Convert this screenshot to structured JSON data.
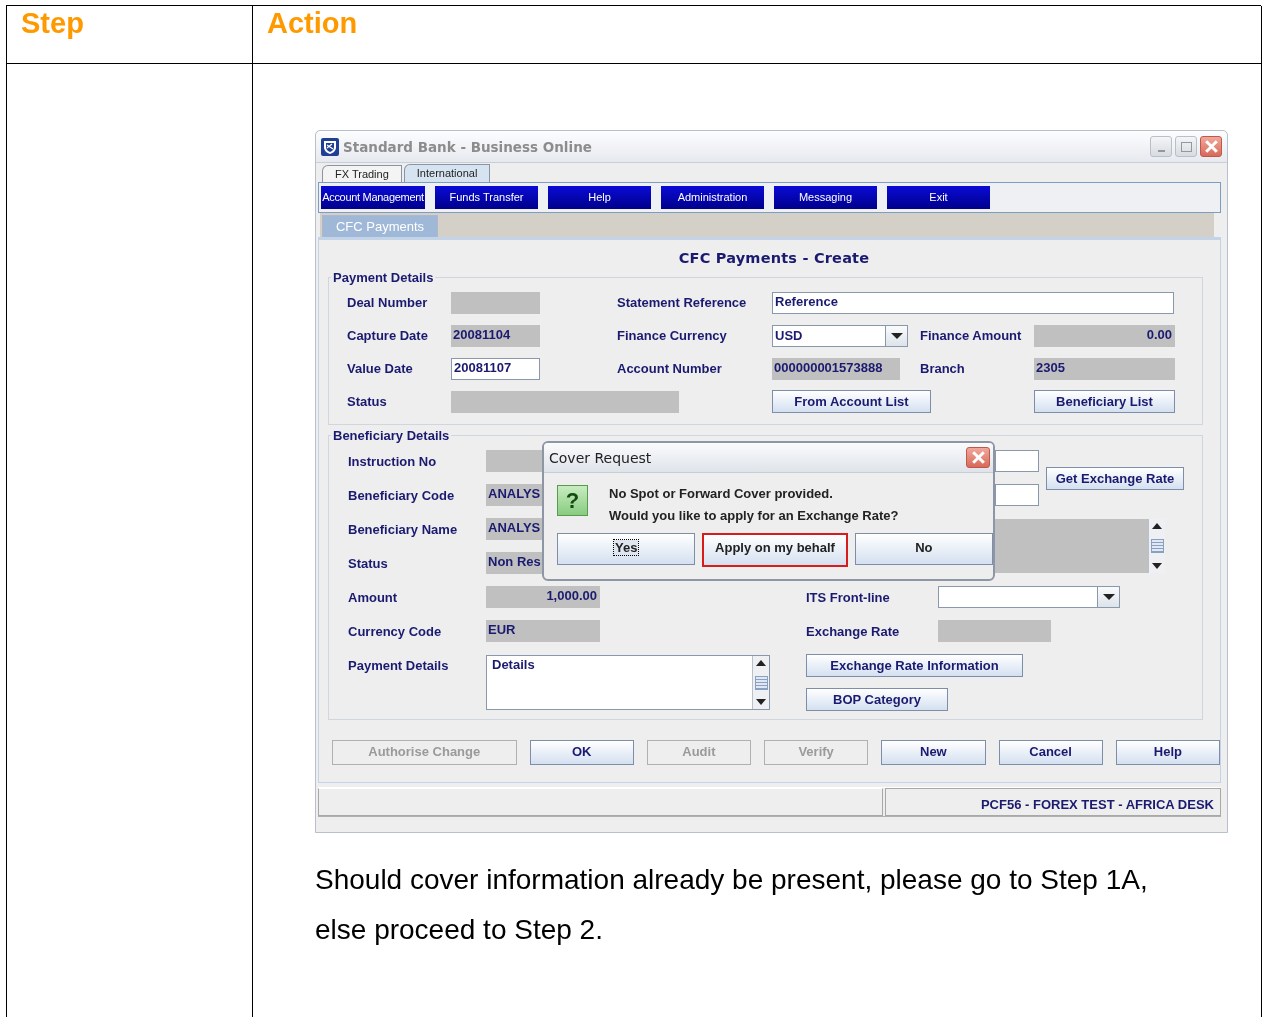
{
  "document": {
    "headers": [
      "Step",
      "Action"
    ],
    "caption": "Should cover information already be present, please go to Step 1A, else proceed to Step 2."
  },
  "app": {
    "title": "Standard Bank - Business Online",
    "tabs": [
      {
        "label": "FX Trading",
        "selected": false
      },
      {
        "label": "International",
        "selected": true
      }
    ],
    "menu": [
      "Account Management",
      "Funds Transfer",
      "Help",
      "Administration",
      "Messaging",
      "Exit"
    ],
    "section_tabs": [
      {
        "label": "CFC Payments",
        "selected": true
      }
    ],
    "heading": "CFC Payments - Create",
    "payment_details": {
      "legend": "Payment Details",
      "items": [
        {
          "kind": "label",
          "text": "Deal Number"
        },
        {
          "kind": "readonly"
        },
        {
          "kind": "label",
          "text": "Statement Reference"
        },
        {
          "kind": "input",
          "value": "Reference"
        },
        {
          "kind": "label",
          "text": "Capture Date"
        },
        {
          "kind": "readonly",
          "value": "20081104"
        },
        {
          "kind": "label",
          "text": "Finance Currency"
        },
        {
          "kind": "select",
          "value": "USD"
        },
        {
          "kind": "label",
          "text": "Finance Amount"
        },
        {
          "kind": "amount",
          "value": "0.00"
        },
        {
          "kind": "label",
          "text": "Value Date"
        },
        {
          "kind": "input",
          "value": "20081107"
        },
        {
          "kind": "label",
          "text": "Account Number"
        },
        {
          "kind": "readonly",
          "value": "000000001573888"
        },
        {
          "kind": "label",
          "text": "Branch"
        },
        {
          "kind": "readonly",
          "value": "2305"
        },
        {
          "kind": "label",
          "text": "Status"
        },
        {
          "kind": "readonly"
        },
        {
          "kind": "button",
          "text": "From Account List"
        },
        {
          "kind": "button",
          "text": "Beneficiary List"
        }
      ]
    },
    "beneficiary_details": {
      "legend": "Beneficiary Details",
      "items": [
        {
          "kind": "label",
          "text": "Instruction No"
        },
        {
          "kind": "readonly"
        },
        {
          "kind": "label",
          "text": "Beneficiary Code"
        },
        {
          "kind": "readonly",
          "value": "ANALYS"
        },
        {
          "kind": "label",
          "text": "Beneficiary Name"
        },
        {
          "kind": "readonly",
          "value": "ANALYS"
        },
        {
          "kind": "label",
          "text": "Status"
        },
        {
          "kind": "readonly",
          "value": "Non Res"
        },
        {
          "kind": "label",
          "text": "Amount"
        },
        {
          "kind": "amount",
          "value": "1,000.00"
        },
        {
          "kind": "label",
          "text": "Currency Code"
        },
        {
          "kind": "readonly",
          "value": "EUR"
        },
        {
          "kind": "label",
          "text": "Payment Details"
        },
        {
          "kind": "textarea",
          "value": "Details"
        },
        {
          "kind": "input"
        },
        {
          "kind": "input"
        },
        {
          "kind": "button",
          "text": "Get Exchange Rate"
        },
        {
          "kind": "readonly-box"
        },
        {
          "kind": "label",
          "text": "ITS Front-line"
        },
        {
          "kind": "select"
        },
        {
          "kind": "label",
          "text": "Exchange Rate"
        },
        {
          "kind": "readonly"
        },
        {
          "kind": "button",
          "text": "Exchange Rate Information"
        },
        {
          "kind": "button",
          "text": "BOP Category"
        }
      ]
    },
    "actions": [
      {
        "label": "Authorise Change",
        "disabled": true
      },
      {
        "label": "OK",
        "disabled": false
      },
      {
        "label": "Audit",
        "disabled": true
      },
      {
        "label": "Verify",
        "disabled": true
      },
      {
        "label": "New",
        "disabled": false
      },
      {
        "label": "Cancel",
        "disabled": false
      },
      {
        "label": "Help",
        "disabled": false
      }
    ],
    "status_bar": {
      "text": "PCF56 - FOREX TEST - AFRICA DESK"
    },
    "dialog": {
      "title": "Cover Request",
      "icon_glyph": "?",
      "message": [
        "No Spot or Forward Cover provided.",
        "Would you like to apply for an Exchange Rate?"
      ],
      "buttons": [
        {
          "label": "Yes",
          "focused": true,
          "highlighted": false
        },
        {
          "label": "Apply on my behalf",
          "focused": false,
          "highlighted": true
        },
        {
          "label": "No",
          "focused": false,
          "highlighted": false
        }
      ]
    }
  }
}
